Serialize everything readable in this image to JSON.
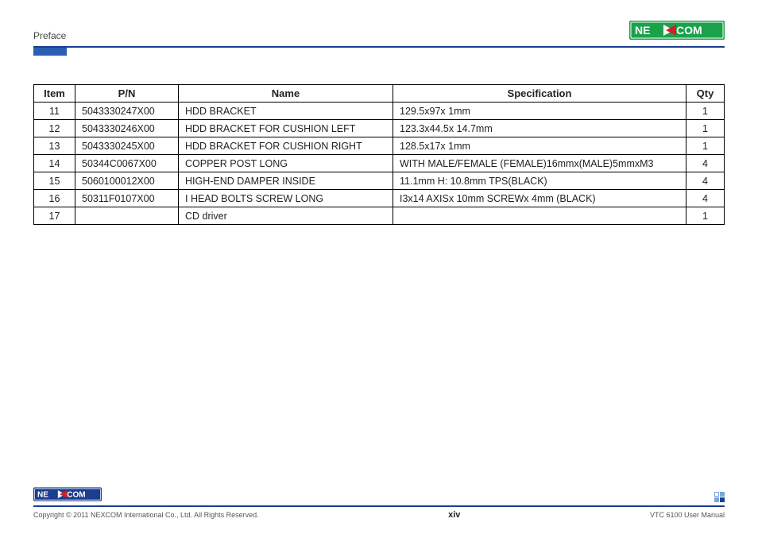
{
  "header": {
    "section": "Preface",
    "logo_text_left": "NE",
    "logo_text_right": "COM"
  },
  "table": {
    "headers": {
      "item": "Item",
      "pn": "P/N",
      "name": "Name",
      "spec": "Specification",
      "qty": "Qty"
    },
    "rows": [
      {
        "item": "11",
        "pn": "5043330247X00",
        "name": "HDD BRACKET",
        "spec": "129.5x97x 1mm",
        "qty": "1"
      },
      {
        "item": "12",
        "pn": "5043330246X00",
        "name": "HDD BRACKET FOR CUSHION LEFT",
        "spec": "123.3x44.5x 14.7mm",
        "qty": "1"
      },
      {
        "item": "13",
        "pn": "5043330245X00",
        "name": "HDD BRACKET FOR CUSHION RIGHT",
        "spec": "128.5x17x 1mm",
        "qty": "1"
      },
      {
        "item": "14",
        "pn": "50344C0067X00",
        "name": "COPPER POST LONG",
        "spec": "WITH MALE/FEMALE (FEMALE)16mmx(MALE)5mmxM3",
        "qty": "4"
      },
      {
        "item": "15",
        "pn": "5060100012X00",
        "name": "HIGH-END DAMPER INSIDE",
        "spec": "11.1mm H: 10.8mm TPS(BLACK)",
        "qty": "4"
      },
      {
        "item": "16",
        "pn": "50311F0107X00",
        "name": "I HEAD BOLTS SCREW LONG",
        "spec": "I3x14 AXISx 10mm SCREWx 4mm (BLACK)",
        "qty": "4"
      },
      {
        "item": "17",
        "pn": "",
        "name": "CD driver",
        "spec": "",
        "qty": "1"
      }
    ]
  },
  "footer": {
    "copyright": "Copyright © 2011 NEXCOM International Co., Ltd. All Rights Reserved.",
    "page": "xiv",
    "doc_title": "VTC 6100 User Manual"
  }
}
